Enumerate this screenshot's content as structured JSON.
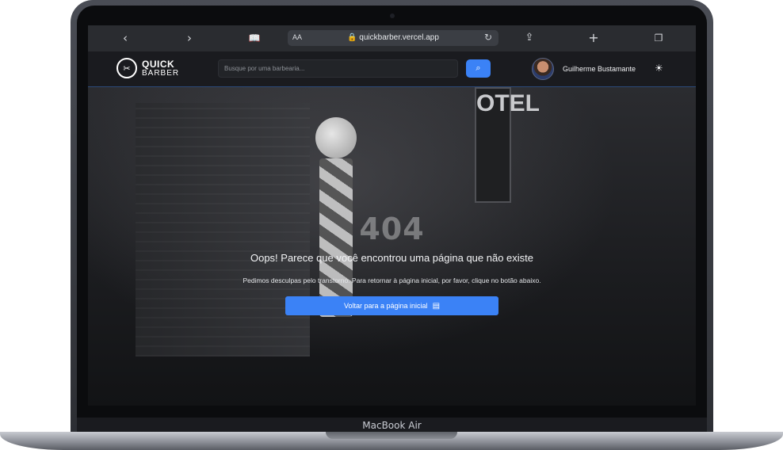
{
  "device": {
    "label": "MacBook Air"
  },
  "safari": {
    "back_icon": "‹",
    "forward_icon": "›",
    "reader_icon": "📖",
    "aa_label": "AA",
    "url": "🔒 quickbarber.vercel.app",
    "reload_icon": "↻",
    "share_icon": "⇪",
    "new_tab_icon": "+",
    "tabs_icon": "❐"
  },
  "navbar": {
    "logo_mark": "✂",
    "logo_line1": "QUICK",
    "logo_line2": "BARBER",
    "search_placeholder": "Busque por uma barbearia...",
    "search_icon": "⌕",
    "username": "Guilherme Bustamante",
    "theme_icon": "☀"
  },
  "page": {
    "error_code": "404",
    "title": "Oops! Parece que você encontrou uma página que não existe",
    "subtitle": "Pedimos desculpas pelo transtorno. Para retornar à página inicial, por favor, clique no botão abaixo.",
    "button_label": "Voltar para a página inicial",
    "button_icon": "▤",
    "background_sign": "OTEL"
  }
}
